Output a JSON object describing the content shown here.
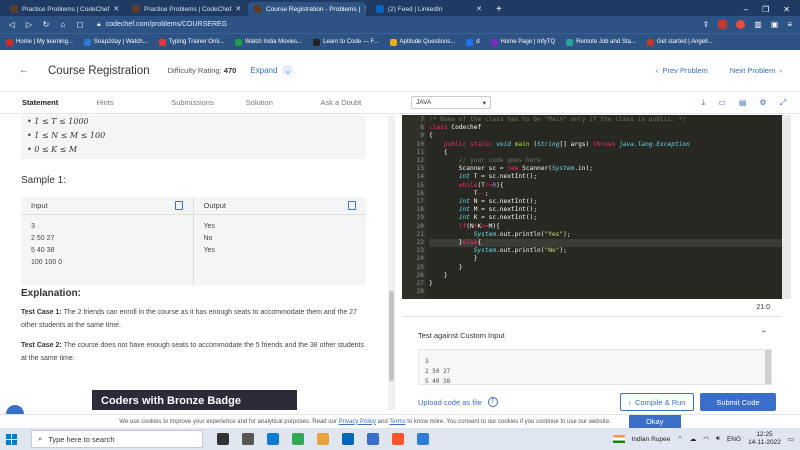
{
  "browser": {
    "tabs": [
      {
        "label": "Practice Problems | CodeChef",
        "active": false
      },
      {
        "label": "Practice Problems | CodeChef",
        "active": false
      },
      {
        "label": "Course Registration - Problems |",
        "active": true
      },
      {
        "label": "(2) Feed | LinkedIn",
        "active": false
      }
    ],
    "url": "codechef.com/problems/COURSEREG",
    "bookmarks": [
      "Home | My learning...",
      "Soap2day | Watch...",
      "Typing Trainer Onli...",
      "Watch India Movies...",
      "Learn to Code — F...",
      "Aptitude Questions...",
      "d",
      "Home Page | InfyTQ",
      "Remote Job and Sta...",
      "Get started | Angell..."
    ],
    "bookmark_colors": [
      "#d62828",
      "#2b7bd6",
      "#e03a3a",
      "#1a9e4b",
      "#222222",
      "#e8b10f",
      "#1a73e8",
      "#7b2cbf",
      "#2aa198",
      "#c0392b"
    ]
  },
  "problem": {
    "title": "Course Registration",
    "rating_label": "Difficulty Rating:",
    "rating_value": "470",
    "expand_label": "Expand",
    "prev_label": "Prev Problem",
    "next_label": "Next Problem"
  },
  "tabs": [
    "Statement",
    "Hints",
    "Submissions",
    "Solution",
    "Ask a Doubt"
  ],
  "language": "JAVA",
  "constraints": [
    "• 1 ≤ T ≤ 1000",
    "• 1 ≤ N ≤ M ≤ 100",
    "• 0 ≤ K ≤ M"
  ],
  "sample": {
    "heading": "Sample 1:",
    "input_label": "Input",
    "output_label": "Output",
    "input_lines": [
      "3",
      "2 50 27",
      "5 40 38",
      "100 100 0"
    ],
    "output_lines": [
      "Yes",
      "No",
      "Yes"
    ]
  },
  "explanation": {
    "heading": "Explanation:",
    "case1_label": "Test Case 1:",
    "case1_text": "The 2 friends can enroll in the course as it has enough seats to accommodate them and the 27 other students at the same time.",
    "case2_label": "Test Case 2:",
    "case2_text": "The course does not have enough seats to accommodate the 5 friends and the 38 other students at the same time."
  },
  "badge": "Coders with Bronze Badge",
  "code_lines": [
    {
      "n": "7",
      "html": "<span class=\"cm\">/* Name of the class has to be \"Main\" only if the class is public. */</span>"
    },
    {
      "n": "8",
      "html": "<span class=\"kw\">class</span> Codechef"
    },
    {
      "n": "9",
      "html": "{"
    },
    {
      "n": "10",
      "html": "    <span class=\"kw\">public static</span> <span class=\"ty\">void</span> <span class=\"fn\">main</span> (<span class=\"ty\">String</span>[] args) <span class=\"kw\">throws</span> <span class=\"ty\">java.lang.Exception</span>"
    },
    {
      "n": "11",
      "html": "    {"
    },
    {
      "n": "12",
      "html": "        <span class=\"cm\">// your code goes here</span>"
    },
    {
      "n": "13",
      "html": "        Scanner sc = <span class=\"kw\">new</span> Scanner(<span class=\"ty\">System</span>.in);"
    },
    {
      "n": "14",
      "html": "        <span class=\"ty\">int</span> T = sc.nextInt();"
    },
    {
      "n": "15",
      "html": "        <span class=\"kw\">while</span>(T<span class=\"kw\">!=</span><span class=\"nm\">0</span>){"
    },
    {
      "n": "16",
      "html": "            T<span class=\"kw\">--</span>;"
    },
    {
      "n": "17",
      "html": "        <span class=\"ty\">int</span> N = sc.nextInt();"
    },
    {
      "n": "18",
      "html": "        <span class=\"ty\">int</span> M = sc.nextInt();"
    },
    {
      "n": "19",
      "html": "        <span class=\"ty\">int</span> K = sc.nextInt();"
    },
    {
      "n": "20",
      "html": "        <span class=\"kw\">if</span>(N<span class=\"kw\">+</span>K<span class=\"kw\">&lt;=</span>M){"
    },
    {
      "n": "21",
      "html": "            <span class=\"ty\">System</span>.out.println(<span class=\"st\">\"Yes\"</span>);"
    },
    {
      "n": "22",
      "html": "        }<span class=\"kw\">else</span>{"
    },
    {
      "n": "23",
      "html": "            <span class=\"ty\">System</span>.out.println(<span class=\"st\">\"No\"</span>);"
    },
    {
      "n": "24",
      "html": "            }"
    },
    {
      "n": "25",
      "html": "        }"
    },
    {
      "n": "26",
      "html": "    }"
    },
    {
      "n": "27",
      "html": "}"
    },
    {
      "n": "28",
      "html": ""
    }
  ],
  "cursor_line": "22",
  "editor_status": "21:0",
  "custom_input": {
    "heading": "Test against Custom Input",
    "lines": [
      "3",
      "2 50 27",
      "5 40 38"
    ]
  },
  "actions": {
    "upload_label": "Upload code as file",
    "run_label": "Compile & Run",
    "submit_label": "Submit Code"
  },
  "cookie": {
    "text_before": "We use cookies to improve your experience and for analytical purposes. Read our",
    "privacy": "Privacy Policy",
    "and": "and",
    "terms": "Terms",
    "text_after": "to know more. You consent to our cookies if you continue to use our website.",
    "okay": "Okay"
  },
  "taskbar": {
    "search_placeholder": "Type here to search",
    "currency": "Indian Rupee",
    "lang": "ENG",
    "time": "12:25",
    "date": "14-11-2022",
    "app_colors": [
      "#333333",
      "#555555",
      "#0f7bd8",
      "#34a853",
      "#e8a33d",
      "#0067b8",
      "#3b6ec9",
      "#fb542b",
      "#2d7dd2"
    ]
  }
}
